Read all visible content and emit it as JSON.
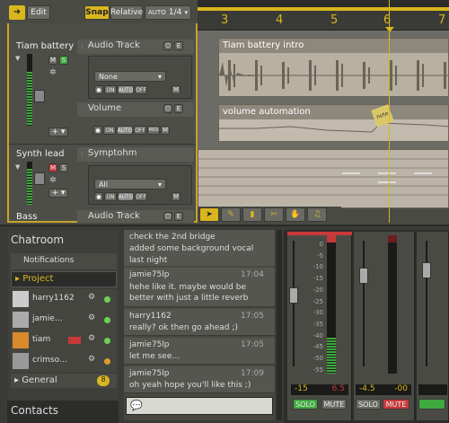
{
  "toolbar": {
    "edit_label": "Edit",
    "snap_label": "Snap",
    "relative_label": "Relative",
    "auto_label": "AUTO",
    "fraction_label": "1/4"
  },
  "ruler": {
    "marks": [
      "3",
      "4",
      "5",
      "6",
      "7"
    ]
  },
  "tracks": [
    {
      "name": "Tiam battery",
      "type_label": "Audio Track",
      "m": "M",
      "s": "S",
      "input_value": "None",
      "on": "ON",
      "auto": "AUTO",
      "off": "OFF",
      "m2": "M"
    },
    {
      "automation_label": "Volume",
      "on": "ON",
      "auto": "AUTO",
      "off": "OFF",
      "midi": "MIDI",
      "m2": "M"
    },
    {
      "name": "Synth lead",
      "type_label": "Symptohm",
      "m": "M",
      "s": "S",
      "input_value": "All",
      "on": "ON",
      "auto": "AUTO",
      "off": "OFF",
      "m2": "M"
    },
    {
      "name": "Bass",
      "type_label": "Audio Track"
    }
  ],
  "clips": {
    "clip1_title": "Tiam battery intro",
    "clip2_title": "volume automation",
    "note_label": "note"
  },
  "chat": {
    "title": "Chatroom",
    "notifications": "Notifications",
    "project": "Project",
    "users": [
      {
        "name": "harry1162"
      },
      {
        "name": "jamie…"
      },
      {
        "name": "tiam"
      },
      {
        "name": "crimso…"
      }
    ],
    "general": "General",
    "general_count": "8",
    "contacts": "Contacts",
    "top_message": "check the 2nd bridge\nadded some background vocal\nlast night",
    "messages": [
      {
        "user": "jamie75lp",
        "time": "17:04",
        "text": "hehe like it. maybe would be better with just a little reverb"
      },
      {
        "user": "harry1162",
        "time": "17:05",
        "text": "really? ok then go ahead ;)"
      },
      {
        "user": "jamie75lp",
        "time": "17:05",
        "text": "let me see…"
      },
      {
        "user": "jamie75lp",
        "time": "17:09",
        "text": "oh yeah hope you'll like this ;)"
      }
    ]
  },
  "mixer": {
    "scale": [
      "0",
      "-5",
      "-10",
      "-15",
      "-20",
      "-25",
      "-30",
      "-35",
      "-40",
      "-45",
      "-50",
      "-55"
    ],
    "channels": [
      {
        "left_val": "-15",
        "right_val": "6.5",
        "solo": "SOLO",
        "mute": "MUTE"
      },
      {
        "left_val": "-4.5",
        "right_val": "-00",
        "solo": "SOLO",
        "mute": "MUTE"
      }
    ]
  },
  "colors": {
    "accent": "#d9b61e",
    "mute_red": "#c73a3a",
    "solo_green": "#3fa83f"
  }
}
